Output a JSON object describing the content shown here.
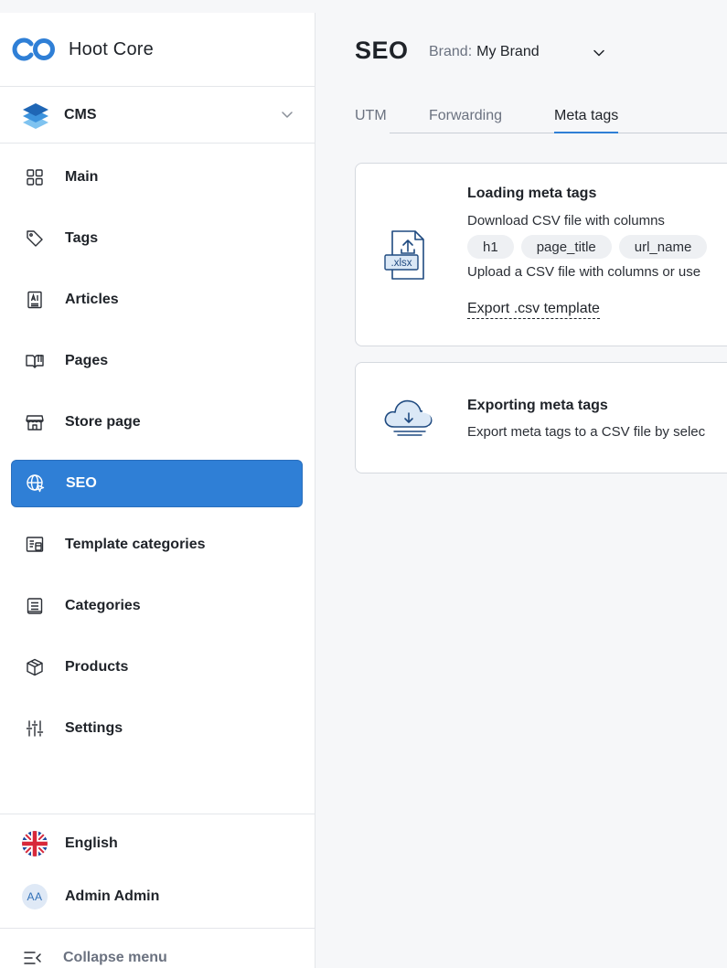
{
  "app": {
    "name": "Hoot Core",
    "accent": "#2f7fd6"
  },
  "sidebar": {
    "section": {
      "label": "CMS",
      "icon": "layers-icon"
    },
    "items": [
      {
        "label": "Main",
        "icon": "grid-icon",
        "active": false
      },
      {
        "label": "Tags",
        "icon": "tag-icon",
        "active": false
      },
      {
        "label": "Articles",
        "icon": "article-icon",
        "active": false
      },
      {
        "label": "Pages",
        "icon": "book-icon",
        "active": false
      },
      {
        "label": "Store page",
        "icon": "store-icon",
        "active": false
      },
      {
        "label": "SEO",
        "icon": "globe-icon",
        "active": true
      },
      {
        "label": "Template categories",
        "icon": "template-icon",
        "active": false
      },
      {
        "label": "Categories",
        "icon": "list-icon",
        "active": false
      },
      {
        "label": "Products",
        "icon": "box-icon",
        "active": false
      },
      {
        "label": "Settings",
        "icon": "sliders-icon",
        "active": false
      }
    ],
    "language": "English",
    "user": {
      "initials": "AA",
      "name": "Admin Admin"
    },
    "collapse_label": "Collapse menu"
  },
  "header": {
    "title": "SEO",
    "brand_label": "Brand:",
    "brand_value": "My Brand"
  },
  "tabs": [
    {
      "label": "UTM",
      "active": false
    },
    {
      "label": "Forwarding",
      "active": false
    },
    {
      "label": "Meta tags",
      "active": true
    }
  ],
  "import_card": {
    "title": "Loading meta tags",
    "download_text": "Download CSV file with columns",
    "columns": [
      "h1",
      "page_title",
      "url_name"
    ],
    "upload_text": "Upload a CSV file with columns or use",
    "file_badge": ".xlsx",
    "export_template_link": "Export .csv template"
  },
  "export_card": {
    "title": "Exporting meta tags",
    "text": "Export meta tags to a CSV file by selec"
  }
}
